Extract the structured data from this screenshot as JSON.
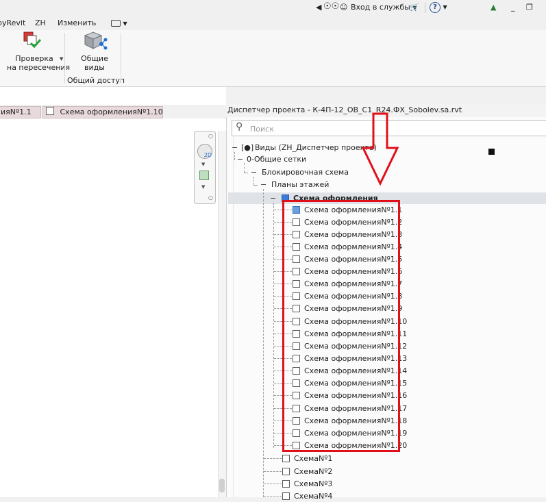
{
  "titlebar": {
    "signin": "Вход в службы",
    "help": "?",
    "minimize": "_"
  },
  "ribbon": {
    "menu": [
      "pyRevit",
      "ZH",
      "Изменить"
    ],
    "tools": [
      {
        "line1": "Проверка",
        "line2": "на пересечения"
      },
      {
        "line1": "Общие",
        "line2": "виды"
      }
    ],
    "panel_label": "Общий доступ"
  },
  "doc_tabs": [
    "ияNº1.1",
    "Схема оформленияNº1.10"
  ],
  "browser": {
    "title": "Диспетчер проекта - К-4П-12_ОВ_С1_R24.ФХ_Sobolev.sa.rvt",
    "search_placeholder": "Поиск",
    "root": "Виды (ZH_Диспетчер проекта)",
    "level1": "0-Общие сетки",
    "level2": "Блокировочная схема",
    "level3": "Планы этажей",
    "group": "Схема оформления",
    "views": [
      "Схема оформленияNº1.1",
      "Схема оформленияNº1.2",
      "Схема оформленияNº1.3",
      "Схема оформленияNº1.4",
      "Схема оформленияNº1.5",
      "Схема оформленияNº1.6",
      "Схема оформленияNº1.7",
      "Схема оформленияNº1.8",
      "Схема оформленияNº1.9",
      "Схема оформленияNº1.10",
      "Схема оформленияNº1.11",
      "Схема оформленияNº1.12",
      "Схема оформленияNº1.13",
      "Схема оформленияNº1.14",
      "Схема оформленияNº1.15",
      "Схема оформленияNº1.16",
      "Схема оформленияNº1.17",
      "Схема оформленияNº1.18",
      "Схема оформленияNº1.19",
      "Схема оформленияNº1.20"
    ],
    "schemes": [
      "СхемаNº1",
      "СхемаNº2",
      "СхемаNº3",
      "СхемаNº4"
    ]
  },
  "colors": {
    "highlight": "#e0101a",
    "selected_row": "#dfe3e8",
    "tab_bg": "#e8d9dc"
  }
}
